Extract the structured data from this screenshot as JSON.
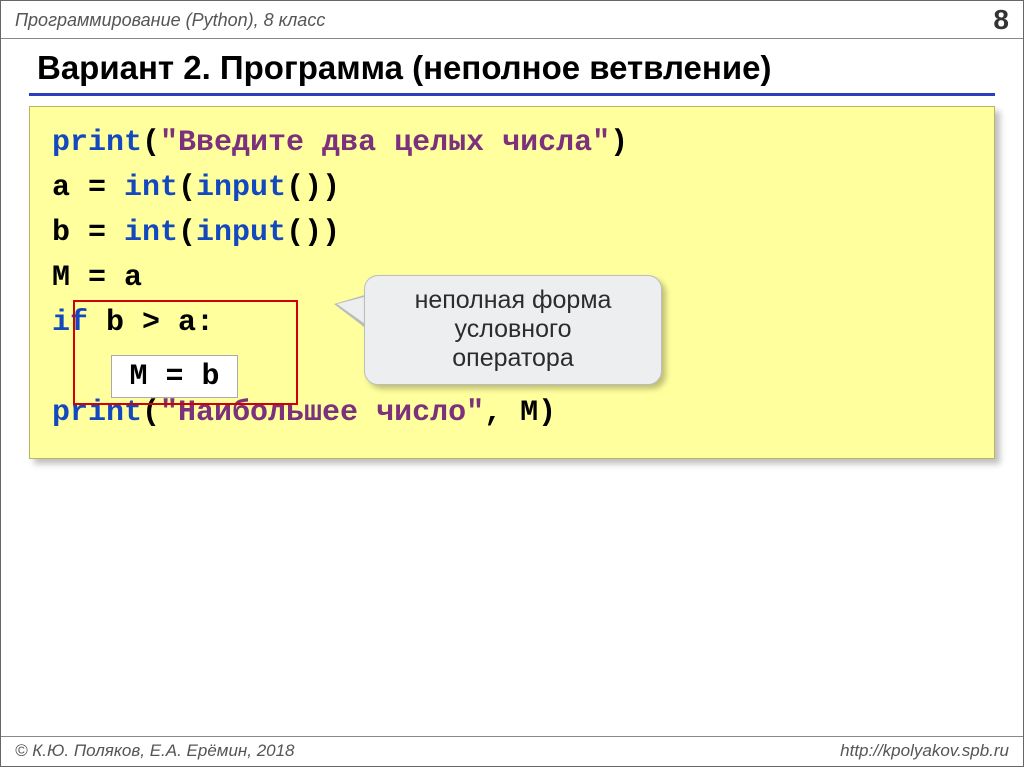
{
  "header": {
    "left": "Программирование (Python), 8 класс",
    "page": "8"
  },
  "title": "Вариант 2. Программа (неполное ветвление)",
  "code": {
    "l1_fn": "print",
    "l1_par_open": "(",
    "l1_str": "\"Введите два целых числа\"",
    "l1_par_close": ")",
    "l2_a": "a = ",
    "l2_int": "int",
    "l2_b": "(",
    "l2_input": "input",
    "l2_c": "())",
    "l3_a": "b = ",
    "l3_int": "int",
    "l3_b": "(",
    "l3_input": "input",
    "l3_c": "())",
    "l4": "M = a",
    "l5_if": "if",
    "l5_rest": " b > a:",
    "l6": "M = b",
    "l7_fn": "print",
    "l7_a": "(",
    "l7_str": "\"Наибольшее число\"",
    "l7_b": ", M)"
  },
  "callout": {
    "line1": "неполная форма",
    "line2": "условного",
    "line3": "оператора"
  },
  "footer": {
    "left": "© К.Ю. Поляков, Е.А. Ерёмин, 2018",
    "right": "http://kpolyakov.spb.ru"
  }
}
